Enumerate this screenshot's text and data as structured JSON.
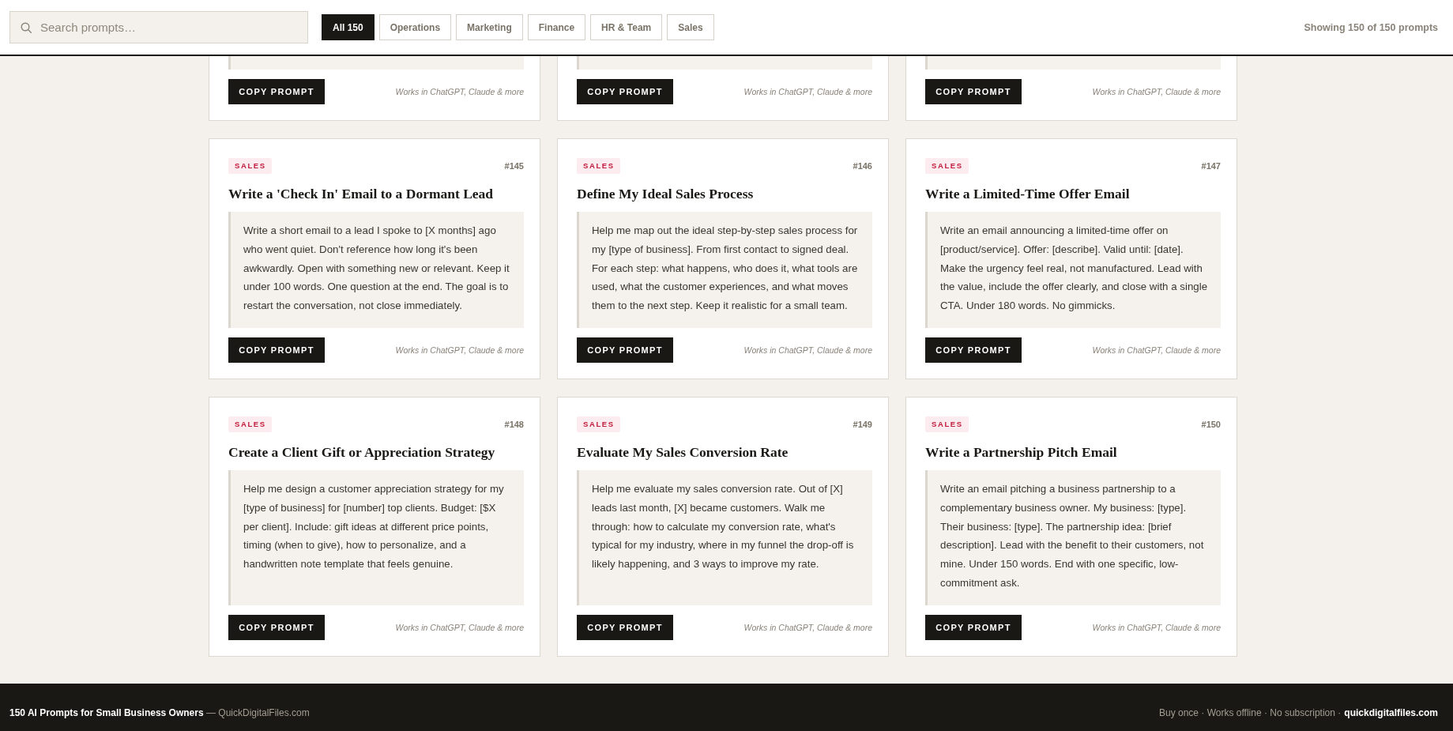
{
  "header": {
    "search": {
      "placeholder": "Search prompts…"
    },
    "filters": [
      {
        "label": "All 150",
        "selected": true
      },
      {
        "label": "Operations",
        "selected": false
      },
      {
        "label": "Marketing",
        "selected": false
      },
      {
        "label": "Finance",
        "selected": false
      },
      {
        "label": "HR & Team",
        "selected": false
      },
      {
        "label": "Sales",
        "selected": false
      }
    ],
    "count": "Showing 150 of 150 prompts"
  },
  "partial_cards": [
    {
      "button": "COPY PROMPT",
      "note": "Works in ChatGPT, Claude & more"
    },
    {
      "button": "COPY PROMPT",
      "note": "Works in ChatGPT, Claude & more"
    },
    {
      "button": "COPY PROMPT",
      "note": "Works in ChatGPT, Claude & more"
    }
  ],
  "cards": [
    {
      "category": "SALES",
      "number": "#145",
      "title": "Write a 'Check In' Email to a Dormant Lead",
      "prompt": "Write a short email to a lead I spoke to [X months] ago who went quiet. Don't reference how long it's been awkwardly. Open with something new or relevant. Keep it under 100 words. One question at the end. The goal is to restart the conversation, not close immediately.",
      "button": "COPY PROMPT",
      "note": "Works in ChatGPT, Claude & more"
    },
    {
      "category": "SALES",
      "number": "#146",
      "title": "Define My Ideal Sales Process",
      "prompt": "Help me map out the ideal step-by-step sales process for my [type of business]. From first contact to signed deal. For each step: what happens, who does it, what tools are used, what the customer experiences, and what moves them to the next step. Keep it realistic for a small team.",
      "button": "COPY PROMPT",
      "note": "Works in ChatGPT, Claude & more"
    },
    {
      "category": "SALES",
      "number": "#147",
      "title": "Write a Limited-Time Offer Email",
      "prompt": "Write an email announcing a limited-time offer on [product/service]. Offer: [describe]. Valid until: [date]. Make the urgency feel real, not manufactured. Lead with the value, include the offer clearly, and close with a single CTA. Under 180 words. No gimmicks.",
      "button": "COPY PROMPT",
      "note": "Works in ChatGPT, Claude & more"
    },
    {
      "category": "SALES",
      "number": "#148",
      "title": "Create a Client Gift or Appreciation Strategy",
      "prompt": "Help me design a customer appreciation strategy for my [type of business] for [number] top clients. Budget: [$X per client]. Include: gift ideas at different price points, timing (when to give), how to personalize, and a handwritten note template that feels genuine.",
      "button": "COPY PROMPT",
      "note": "Works in ChatGPT, Claude & more"
    },
    {
      "category": "SALES",
      "number": "#149",
      "title": "Evaluate My Sales Conversion Rate",
      "prompt": "Help me evaluate my sales conversion rate. Out of [X] leads last month, [X] became customers. Walk me through: how to calculate my conversion rate, what's typical for my industry, where in my funnel the drop-off is likely happening, and 3 ways to improve my rate.",
      "button": "COPY PROMPT",
      "note": "Works in ChatGPT, Claude & more"
    },
    {
      "category": "SALES",
      "number": "#150",
      "title": "Write a Partnership Pitch Email",
      "prompt": "Write an email pitching a business partnership to a complementary business owner. My business: [type]. Their business: [type]. The partnership idea: [brief description]. Lead with the benefit to their customers, not mine. Under 150 words. End with one specific, low-commitment ask.",
      "button": "COPY PROMPT",
      "note": "Works in ChatGPT, Claude & more"
    }
  ],
  "footer": {
    "left": "**150 AI Prompts for Small Business Owners** — QuickDigitalFiles.com",
    "tagline": "Buy once · Works offline · No subscription ·",
    "link": "quickdigitalfiles.com"
  }
}
